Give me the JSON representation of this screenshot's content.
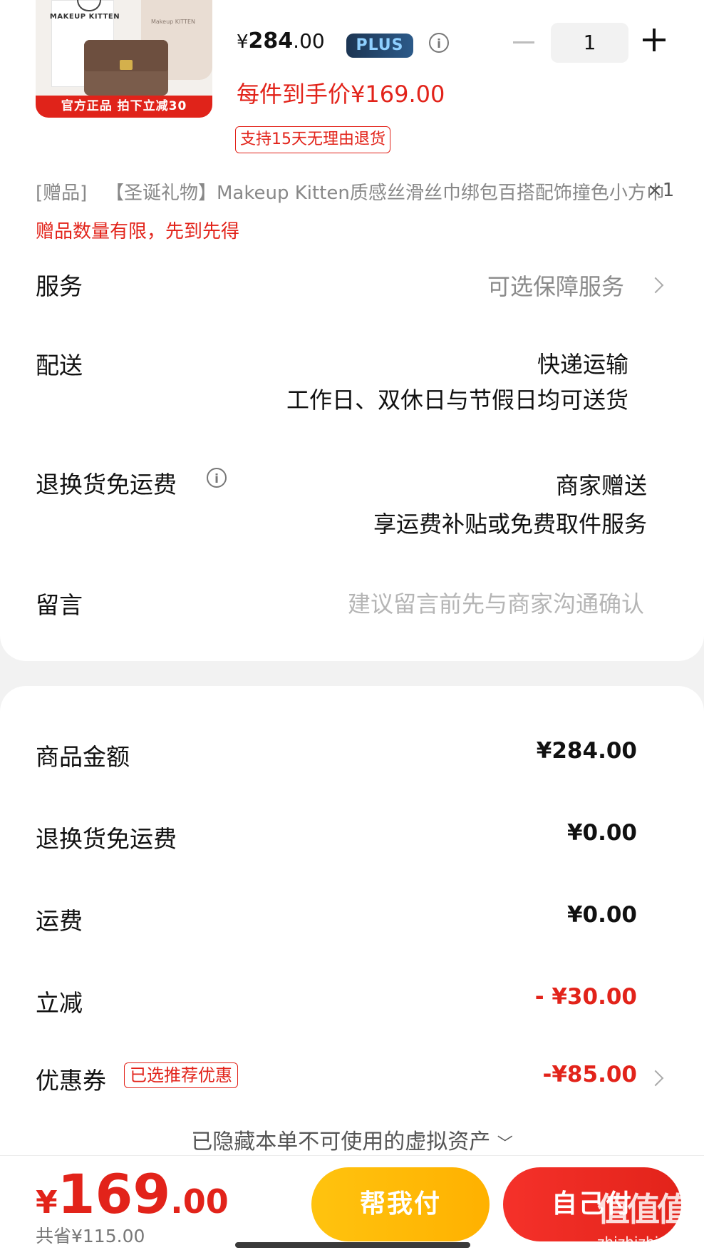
{
  "product": {
    "image_ribbon": "官方正品 拍下立减30",
    "image_brand": "MAKEUP KITTEN",
    "image_pouch_text": "Makeup KITTEN",
    "price_yen": "¥",
    "price_int": "284",
    "price_dec": ".00",
    "plus_badge": "PLUS",
    "final_price": "每件到手价¥169.00",
    "return_tag": "支持15天无理由退货",
    "quantity": "1"
  },
  "gift": {
    "prefix": "[赠品]",
    "name": "【圣诞礼物】Makeup Kitten质感丝滑丝巾绑包百搭配饰撞色小方巾",
    "qty": "×1",
    "limit_note": "赠品数量有限，先到先得"
  },
  "service": {
    "label": "服务",
    "value": "可选保障服务"
  },
  "delivery": {
    "label": "配送",
    "line1": "快递运输",
    "line2": "工作日、双休日与节假日均可送货"
  },
  "return_shipping": {
    "label": "退换货免运费",
    "line1": "商家赠送",
    "line2": "享运费补贴或免费取件服务"
  },
  "message": {
    "label": "留言",
    "placeholder": "建议留言前先与商家沟通确认"
  },
  "summary": {
    "rows": [
      {
        "label": "商品金额",
        "value": "¥284.00"
      },
      {
        "label": "退换货免运费",
        "value": "¥0.00"
      },
      {
        "label": "运费",
        "value": "¥0.00"
      },
      {
        "label": "立减",
        "value": "- ¥30.00"
      },
      {
        "label": "优惠券",
        "value": "-¥85.00"
      }
    ],
    "coupon_tag": "已选推荐优惠",
    "hidden_assets": "已隐藏本单不可使用的虚拟资产"
  },
  "bottom": {
    "total_yen": "¥",
    "total_int": "169",
    "total_dec": ".00",
    "saved": "共省¥115.00",
    "help_pay": "帮我付",
    "self_pay": "自己付"
  },
  "watermark": {
    "text": "值值值",
    "url": "zhizhizhi.com"
  },
  "colors": {
    "accent_red": "#e2231a",
    "help_yellow": "#ffbb0f",
    "plus_navy": "#1c3553"
  }
}
